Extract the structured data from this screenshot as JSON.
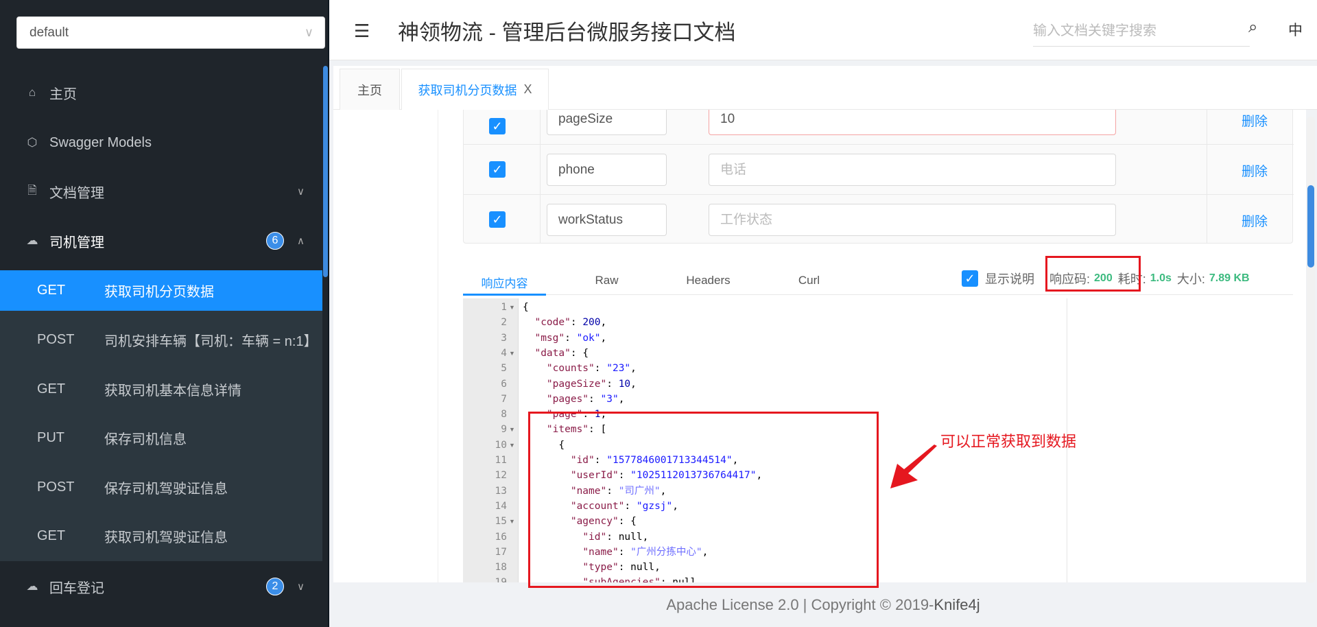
{
  "sidebar": {
    "group_select": "default",
    "menu": [
      {
        "label": "主页",
        "icon": "home-icon"
      },
      {
        "label": "Swagger Models",
        "icon": "cube-icon"
      },
      {
        "label": "文档管理",
        "icon": "document-settings-icon"
      },
      {
        "label": "司机管理",
        "icon": "api-cloud-icon",
        "badge": "6"
      },
      {
        "label": "回车登记",
        "icon": "api-cloud-icon",
        "badge": "2"
      }
    ],
    "endpoints": [
      {
        "method": "GET",
        "label": "获取司机分页数据",
        "active": true
      },
      {
        "method": "POST",
        "label": "司机安排车辆【司机：车辆 = n:1】"
      },
      {
        "method": "GET",
        "label": "获取司机基本信息详情"
      },
      {
        "method": "PUT",
        "label": "保存司机信息"
      },
      {
        "method": "POST",
        "label": "保存司机驾驶证信息"
      },
      {
        "method": "GET",
        "label": "获取司机驾驶证信息"
      }
    ]
  },
  "header": {
    "title": "神领物流 - 管理后台微服务接口文档",
    "search_placeholder": "输入文档关键字搜索",
    "lang": "中"
  },
  "tabs": [
    {
      "label": "主页"
    },
    {
      "label": "获取司机分页数据",
      "close": "X"
    }
  ],
  "params": [
    {
      "name": "pageSize",
      "value": "10",
      "placeholder": "",
      "delete": "删除"
    },
    {
      "name": "phone",
      "value": "",
      "placeholder": "电话",
      "delete": "删除"
    },
    {
      "name": "workStatus",
      "value": "",
      "placeholder": "工作状态",
      "delete": "删除"
    }
  ],
  "response": {
    "tabs": [
      "响应内容",
      "Raw",
      "Headers",
      "Curl"
    ],
    "show_desc": "显示说明",
    "code_label": "响应码:",
    "code": "200",
    "time_label": "耗时:",
    "time": "1.0s",
    "size_label": "大小:",
    "size": "7.89 KB",
    "lines": [
      "{",
      "  \"code\": 200,",
      "  \"msg\": \"ok\",",
      "  \"data\": {",
      "    \"counts\": \"23\",",
      "    \"pageSize\": 10,",
      "    \"pages\": \"3\",",
      "    \"page\": 1,",
      "    \"items\": [",
      "      {",
      "        \"id\": \"1577846001713344514\",",
      "        \"userId\": \"1025112013736764417\",",
      "        \"name\": \"司广州\",",
      "        \"account\": \"gzsj\",",
      "        \"agency\": {",
      "          \"id\": null,",
      "          \"name\": \"广州分拣中心\",",
      "          \"type\": null,",
      "          \"subAgencies\": null"
    ],
    "folds": [
      1,
      4,
      9,
      10,
      15
    ]
  },
  "annotation": {
    "text": "可以正常获取到数据",
    "color": "#e5171f"
  },
  "footer": {
    "license": "Apache License 2.0 | Copyright ",
    "copy": "©",
    "year": " 2019-",
    "brand": "Knife4j"
  },
  "colors": {
    "accent": "#1890ff",
    "sidebar": "#1f252b",
    "success": "#3cba7f"
  }
}
